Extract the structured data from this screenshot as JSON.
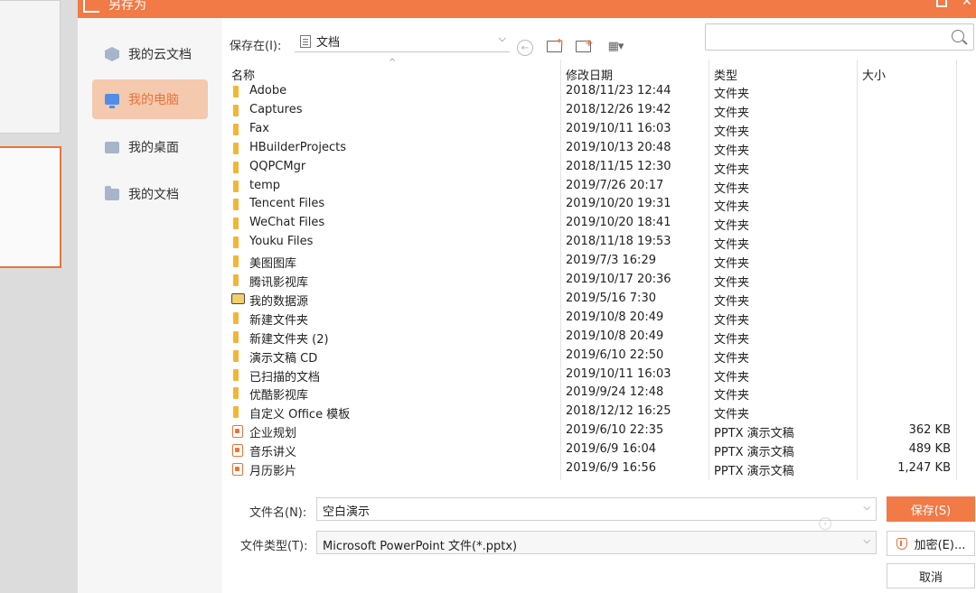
{
  "dialog": {
    "title": "另存为"
  },
  "sidebar": {
    "items": [
      {
        "label": "我的云文档",
        "icon": "cloud-docs-icon"
      },
      {
        "label": "我的电脑",
        "icon": "computer-icon",
        "active": true
      },
      {
        "label": "我的桌面",
        "icon": "desktop-icon"
      },
      {
        "label": "我的文档",
        "icon": "documents-folder-icon"
      }
    ]
  },
  "location": {
    "label": "保存在(I):",
    "value": "文档"
  },
  "search": {
    "placeholder": ""
  },
  "columns": {
    "name": "名称",
    "date": "修改日期",
    "type": "类型",
    "size": "大小"
  },
  "files": [
    {
      "name": "Adobe",
      "date": "2018/11/23 12:44",
      "type": "文件夹",
      "size": "",
      "icon": "folder"
    },
    {
      "name": "Captures",
      "date": "2018/12/26 19:42",
      "type": "文件夹",
      "size": "",
      "icon": "folder"
    },
    {
      "name": "Fax",
      "date": "2019/10/11 16:03",
      "type": "文件夹",
      "size": "",
      "icon": "folder"
    },
    {
      "name": "HBuilderProjects",
      "date": "2019/10/13 20:48",
      "type": "文件夹",
      "size": "",
      "icon": "folder"
    },
    {
      "name": "QQPCMgr",
      "date": "2018/11/15 12:30",
      "type": "文件夹",
      "size": "",
      "icon": "folder"
    },
    {
      "name": "temp",
      "date": "2019/7/26 20:17",
      "type": "文件夹",
      "size": "",
      "icon": "folder"
    },
    {
      "name": "Tencent Files",
      "date": "2019/10/20 19:31",
      "type": "文件夹",
      "size": "",
      "icon": "folder"
    },
    {
      "name": "WeChat Files",
      "date": "2019/10/20 18:41",
      "type": "文件夹",
      "size": "",
      "icon": "folder"
    },
    {
      "name": "Youku Files",
      "date": "2018/11/18 19:53",
      "type": "文件夹",
      "size": "",
      "icon": "folder"
    },
    {
      "name": "美图图库",
      "date": "2019/7/3 16:29",
      "type": "文件夹",
      "size": "",
      "icon": "folder"
    },
    {
      "name": "腾讯影视库",
      "date": "2019/10/17 20:36",
      "type": "文件夹",
      "size": "",
      "icon": "folder"
    },
    {
      "name": "我的数据源",
      "date": "2019/5/16 7:30",
      "type": "文件夹",
      "size": "",
      "icon": "data-source"
    },
    {
      "name": "新建文件夹",
      "date": "2019/10/8 20:49",
      "type": "文件夹",
      "size": "",
      "icon": "folder"
    },
    {
      "name": "新建文件夹 (2)",
      "date": "2019/10/8 20:49",
      "type": "文件夹",
      "size": "",
      "icon": "folder"
    },
    {
      "name": "演示文稿 CD",
      "date": "2019/6/10 22:50",
      "type": "文件夹",
      "size": "",
      "icon": "folder"
    },
    {
      "name": "已扫描的文档",
      "date": "2019/10/11 16:03",
      "type": "文件夹",
      "size": "",
      "icon": "folder"
    },
    {
      "name": "优酷影视库",
      "date": "2019/9/24 12:48",
      "type": "文件夹",
      "size": "",
      "icon": "folder"
    },
    {
      "name": "自定义 Office 模板",
      "date": "2018/12/12 16:25",
      "type": "文件夹",
      "size": "",
      "icon": "folder"
    },
    {
      "name": "企业规划",
      "date": "2019/6/10 22:35",
      "type": "PPTX 演示文稿",
      "size": "362 KB",
      "icon": "pptx"
    },
    {
      "name": "音乐讲义",
      "date": "2019/6/9 16:04",
      "type": "PPTX 演示文稿",
      "size": "489 KB",
      "icon": "pptx"
    },
    {
      "name": "月历影片",
      "date": "2019/6/9 16:56",
      "type": "PPTX 演示文稿",
      "size": "1,247 KB",
      "icon": "pptx"
    }
  ],
  "filename": {
    "label": "文件名(N):",
    "value": "空白演示"
  },
  "filetype": {
    "label": "文件类型(T):",
    "value": "Microsoft PowerPoint 文件(*.pptx)"
  },
  "buttons": {
    "save": "保存(S)",
    "encrypt": "加密(E)...",
    "cancel": "取消"
  },
  "colors": {
    "accent": "#f17a46",
    "active_bg": "#f4c9ae",
    "folder": "#f2b636"
  }
}
